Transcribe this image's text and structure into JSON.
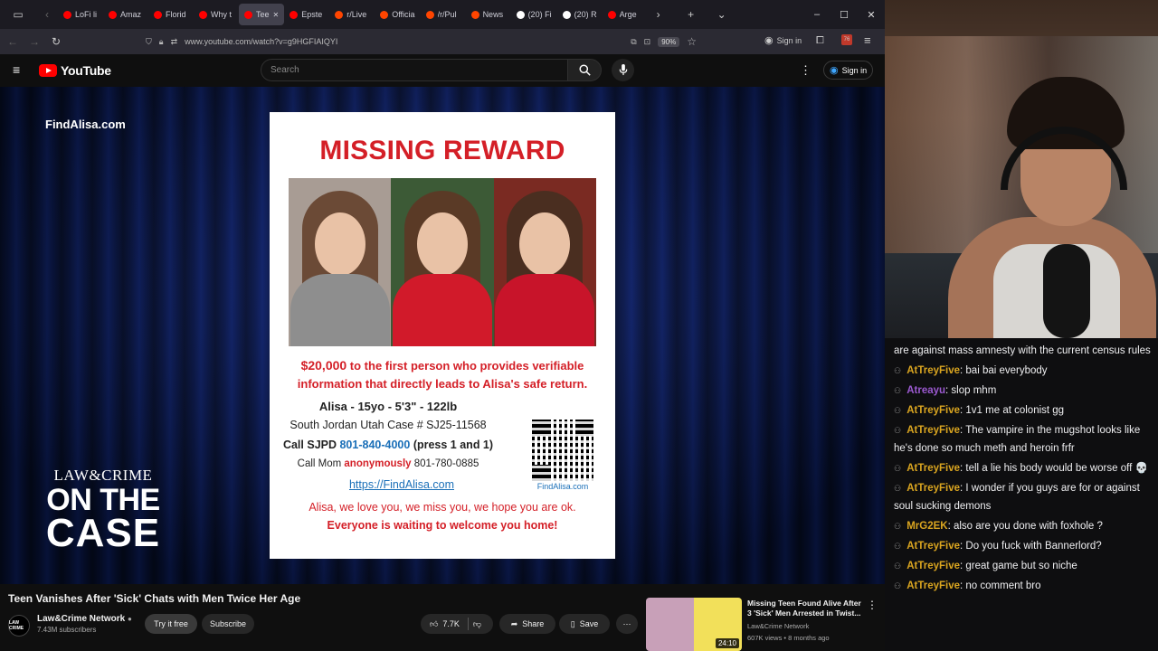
{
  "browser": {
    "tabs": [
      {
        "label": "LoFi li",
        "color": "#ff0000"
      },
      {
        "label": "Amaz",
        "color": "#ff0000"
      },
      {
        "label": "Florid",
        "color": "#ff0000"
      },
      {
        "label": "Why t",
        "color": "#ff0000"
      },
      {
        "label": "Tee",
        "color": "#ff0000",
        "active": true
      },
      {
        "label": "Epste",
        "color": "#ff0000"
      },
      {
        "label": "r/Live",
        "color": "#ff4500"
      },
      {
        "label": "Officia",
        "color": "#ff4500"
      },
      {
        "label": "/r/Pul",
        "color": "#ff4500"
      },
      {
        "label": "News",
        "color": "#ff4500"
      },
      {
        "label": "(20) Fi",
        "color": "#ffffff"
      },
      {
        "label": "(20) R",
        "color": "#ffffff"
      },
      {
        "label": "Arge",
        "color": "#ff0000"
      }
    ],
    "url": "www.youtube.com/watch?v=g9HGFIAIQYI",
    "zoom": "90%",
    "signin": "Sign in",
    "badge": "76"
  },
  "youtube": {
    "logo": "YouTube",
    "search_placeholder": "Search",
    "signin": "Sign in"
  },
  "video": {
    "site_overlay": "FindAlisa.com",
    "brand_line1": "LAW&CRIME",
    "brand_line2": "ON THE",
    "brand_line3": "CASE",
    "poster": {
      "title": "MISSING REWARD",
      "reward_amount": "$20,000",
      "reward_text_1": " to the first person who provides verifiable",
      "reward_text_2": "information that directly leads to Alisa's safe return.",
      "details": "Alisa - 15yo - 5'3\" - 122lb",
      "case": "South Jordan Utah Case # SJ25-11568",
      "call_prefix": "Call SJPD ",
      "call_number": "801-840-4000",
      "call_suffix": " (press 1 and 1)",
      "mom_prefix": "Call Mom ",
      "mom_anon": "anonymously",
      "mom_number": " 801-780-0885",
      "link": "https://FindAlisa.com",
      "qr_label": "FindAlisa.com",
      "love": "Alisa, we love you, we miss you, we hope you are ok.",
      "waiting": "Everyone is waiting to welcome you home!"
    }
  },
  "below": {
    "title": "Teen Vanishes After 'Sick' Chats with Men Twice Her Age",
    "channel": "Law&Crime Network",
    "subs": "7.43M subscribers",
    "avatar_text": "LAW CRIME",
    "try_free": "Try it free",
    "subscribe": "Subscribe",
    "likes": "7.7K",
    "share": "Share",
    "save": "Save"
  },
  "recommended": {
    "title": "Missing Teen Found Alive After 3 'Sick' Men Arrested in Twist...",
    "channel": "Law&Crime Network",
    "meta": "607K views • 8 months ago",
    "duration": "24:10"
  },
  "chat": [
    {
      "user": "",
      "color": "#efeff1",
      "text": "are against mass amnesty with the current census rules",
      "icon": false
    },
    {
      "user": "AtTreyFive",
      "color": "#daa520",
      "text": ": bai bai everybody",
      "icon": true
    },
    {
      "user": "Atreayu",
      "color": "#9b59d0",
      "text": ": slop mhm",
      "icon": true
    },
    {
      "user": "AtTreyFive",
      "color": "#daa520",
      "text": ": 1v1 me at colonist gg",
      "icon": true
    },
    {
      "user": "AtTreyFive",
      "color": "#daa520",
      "text": ": The vampire in the mugshot looks like he's done so much meth and heroin frfr",
      "icon": true
    },
    {
      "user": "AtTreyFive",
      "color": "#daa520",
      "text": ": tell a lie his body would be worse off 💀",
      "icon": true
    },
    {
      "user": "AtTreyFive",
      "color": "#daa520",
      "text": ": I wonder if you guys are for or against soul sucking demons",
      "icon": true
    },
    {
      "user": "MrG2EK",
      "color": "#daa520",
      "text": ": also are you done with foxhole ?",
      "icon": true
    },
    {
      "user": "AtTreyFive",
      "color": "#daa520",
      "text": ": Do you fuck with Bannerlord?",
      "icon": true
    },
    {
      "user": "AtTreyFive",
      "color": "#daa520",
      "text": ": great game but so niche",
      "icon": true
    },
    {
      "user": "AtTreyFive",
      "color": "#daa520",
      "text": ": no comment bro",
      "icon": true
    }
  ]
}
